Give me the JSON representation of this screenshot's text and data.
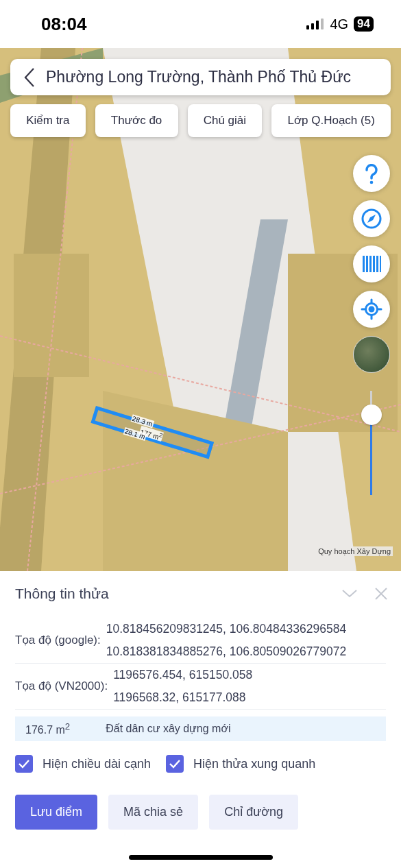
{
  "status_bar": {
    "time": "08:04",
    "network": "4G",
    "battery": "94"
  },
  "search_bar": {
    "title": "Phường Long Trường, Thành Phố Thủ Đức"
  },
  "toolbar": [
    "Kiểm tra",
    "Thước đo",
    "Chú giải",
    "Lớp Q.Hoạch (5)"
  ],
  "parcel": {
    "side_top": "28.3 m",
    "area": "177 m$^{2}$",
    "side_bottom": "28.1 m"
  },
  "zoom_slider": {
    "level": 0.77
  },
  "map_attribution": "Quy hoạch Xây Dựng",
  "panel": {
    "title": "Thông tin thửa",
    "rows": [
      {
        "label": "Tọa độ (google):",
        "values": [
          "10.818456209831245, 106.80484336296584",
          "10.818381834885276, 106.80509026779072"
        ]
      },
      {
        "label": "Tọa độ (VN2000):",
        "values": [
          "1196576.454, 615150.058",
          "1196568.32, 615177.088"
        ]
      }
    ],
    "area": "176.7 m$^{2}$",
    "land_use": "Đất dân cư xây dựng mới",
    "options": [
      {
        "label": "Hiện chiều dài cạnh",
        "checked": true
      },
      {
        "label": "Hiện thửa xung quanh",
        "checked": true
      }
    ],
    "buttons": [
      {
        "label": "Lưu điểm",
        "kind": "primary"
      },
      {
        "label": "Mã chia sẻ",
        "kind": "secondary"
      },
      {
        "label": "Chỉ đường",
        "kind": "secondary"
      }
    ]
  }
}
